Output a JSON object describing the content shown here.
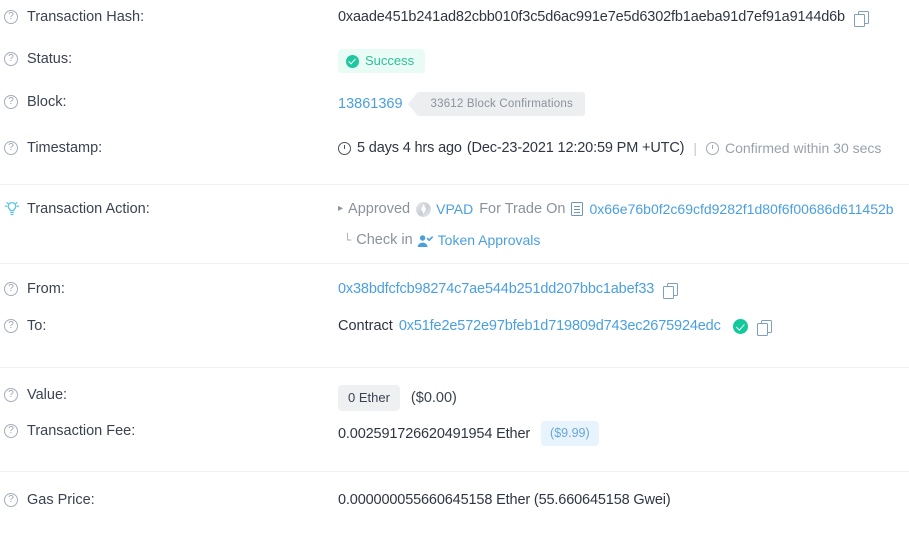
{
  "transaction": {
    "hash": {
      "label": "Transaction Hash:",
      "value": "0xaade451b241ad82cbb010f3c5d6ac991e7e5d6302fb1aeba91d7ef91a9144d6b",
      "copy_icon": "copy-icon"
    },
    "status": {
      "label": "Status:",
      "value": "Success",
      "icon": "check-circle-icon",
      "badge_bg": "#e8fbf4",
      "badge_color": "#2fbf9b"
    },
    "block": {
      "label": "Block:",
      "number": "13861369",
      "confirmations": "33612 Block Confirmations"
    },
    "timestamp": {
      "label": "Timestamp:",
      "clock_icon": "clock-icon",
      "relative": "5 days 4 hrs ago",
      "absolute": "(Dec-23-2021 12:20:59 PM +UTC)",
      "separator": "|",
      "confirmed_icon": "clock-icon",
      "confirmed_text": "Confirmed within 30 secs"
    },
    "action": {
      "label": "Transaction Action:",
      "label_icon": "lightbulb-icon",
      "line1": {
        "caret": "▸",
        "verb": "Approved",
        "token_icon": "vpad-token-icon",
        "token": "VPAD",
        "middle": "For Trade On",
        "doc_icon": "contract-document-icon",
        "address": "0x66e76b0f2c69cfd9282f1d80f6f00686d611452b"
      },
      "line2": {
        "corner": "└",
        "text": "Check in",
        "person_icon": "person-check-icon",
        "link": "Token Approvals"
      }
    },
    "from": {
      "label": "From:",
      "address": "0x38bdfcfcb98274c7ae544b251dd207bbc1abef33",
      "copy_icon": "copy-icon"
    },
    "to": {
      "label": "To:",
      "prefix": "Contract",
      "address": "0x51fe2e572e97bfeb1d719809d743ec2675924edc",
      "verified_icon": "verified-check-icon",
      "copy_icon": "copy-icon"
    },
    "value": {
      "label": "Value:",
      "ether": "0 Ether",
      "usd": "($0.00)"
    },
    "fee": {
      "label": "Transaction Fee:",
      "ether": "0.002591726620491954 Ether",
      "usd": "($9.99)"
    },
    "gas_price": {
      "label": "Gas Price:",
      "value": "0.000000055660645158 Ether (55.660645158 Gwei)"
    }
  },
  "help_icon_glyph": "?",
  "colors": {
    "link": "#4a9fe0",
    "success": "#1ec7a0",
    "muted": "#8b929c",
    "text": "#2f3542"
  }
}
